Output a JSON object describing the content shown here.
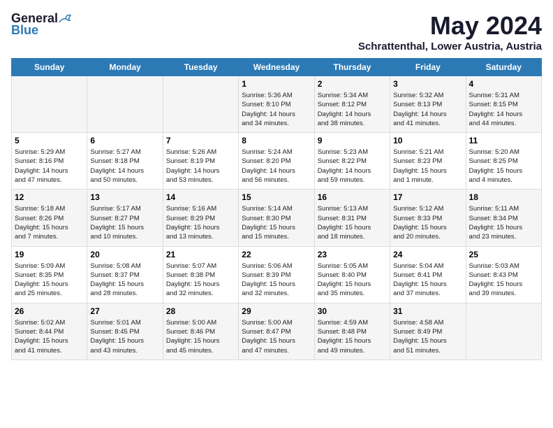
{
  "logo": {
    "general": "General",
    "blue": "Blue"
  },
  "title": "May 2024",
  "subtitle": "Schrattenthal, Lower Austria, Austria",
  "days_of_week": [
    "Sunday",
    "Monday",
    "Tuesday",
    "Wednesday",
    "Thursday",
    "Friday",
    "Saturday"
  ],
  "weeks": [
    [
      {
        "day": "",
        "content": ""
      },
      {
        "day": "",
        "content": ""
      },
      {
        "day": "",
        "content": ""
      },
      {
        "day": "1",
        "content": "Sunrise: 5:36 AM\nSunset: 8:10 PM\nDaylight: 14 hours\nand 34 minutes."
      },
      {
        "day": "2",
        "content": "Sunrise: 5:34 AM\nSunset: 8:12 PM\nDaylight: 14 hours\nand 38 minutes."
      },
      {
        "day": "3",
        "content": "Sunrise: 5:32 AM\nSunset: 8:13 PM\nDaylight: 14 hours\nand 41 minutes."
      },
      {
        "day": "4",
        "content": "Sunrise: 5:31 AM\nSunset: 8:15 PM\nDaylight: 14 hours\nand 44 minutes."
      }
    ],
    [
      {
        "day": "5",
        "content": "Sunrise: 5:29 AM\nSunset: 8:16 PM\nDaylight: 14 hours\nand 47 minutes."
      },
      {
        "day": "6",
        "content": "Sunrise: 5:27 AM\nSunset: 8:18 PM\nDaylight: 14 hours\nand 50 minutes."
      },
      {
        "day": "7",
        "content": "Sunrise: 5:26 AM\nSunset: 8:19 PM\nDaylight: 14 hours\nand 53 minutes."
      },
      {
        "day": "8",
        "content": "Sunrise: 5:24 AM\nSunset: 8:20 PM\nDaylight: 14 hours\nand 56 minutes."
      },
      {
        "day": "9",
        "content": "Sunrise: 5:23 AM\nSunset: 8:22 PM\nDaylight: 14 hours\nand 59 minutes."
      },
      {
        "day": "10",
        "content": "Sunrise: 5:21 AM\nSunset: 8:23 PM\nDaylight: 15 hours\nand 1 minute."
      },
      {
        "day": "11",
        "content": "Sunrise: 5:20 AM\nSunset: 8:25 PM\nDaylight: 15 hours\nand 4 minutes."
      }
    ],
    [
      {
        "day": "12",
        "content": "Sunrise: 5:18 AM\nSunset: 8:26 PM\nDaylight: 15 hours\nand 7 minutes."
      },
      {
        "day": "13",
        "content": "Sunrise: 5:17 AM\nSunset: 8:27 PM\nDaylight: 15 hours\nand 10 minutes."
      },
      {
        "day": "14",
        "content": "Sunrise: 5:16 AM\nSunset: 8:29 PM\nDaylight: 15 hours\nand 13 minutes."
      },
      {
        "day": "15",
        "content": "Sunrise: 5:14 AM\nSunset: 8:30 PM\nDaylight: 15 hours\nand 15 minutes."
      },
      {
        "day": "16",
        "content": "Sunrise: 5:13 AM\nSunset: 8:31 PM\nDaylight: 15 hours\nand 18 minutes."
      },
      {
        "day": "17",
        "content": "Sunrise: 5:12 AM\nSunset: 8:33 PM\nDaylight: 15 hours\nand 20 minutes."
      },
      {
        "day": "18",
        "content": "Sunrise: 5:11 AM\nSunset: 8:34 PM\nDaylight: 15 hours\nand 23 minutes."
      }
    ],
    [
      {
        "day": "19",
        "content": "Sunrise: 5:09 AM\nSunset: 8:35 PM\nDaylight: 15 hours\nand 25 minutes."
      },
      {
        "day": "20",
        "content": "Sunrise: 5:08 AM\nSunset: 8:37 PM\nDaylight: 15 hours\nand 28 minutes."
      },
      {
        "day": "21",
        "content": "Sunrise: 5:07 AM\nSunset: 8:38 PM\nDaylight: 15 hours\nand 32 minutes."
      },
      {
        "day": "22",
        "content": "Sunrise: 5:06 AM\nSunset: 8:39 PM\nDaylight: 15 hours\nand 32 minutes."
      },
      {
        "day": "23",
        "content": "Sunrise: 5:05 AM\nSunset: 8:40 PM\nDaylight: 15 hours\nand 35 minutes."
      },
      {
        "day": "24",
        "content": "Sunrise: 5:04 AM\nSunset: 8:41 PM\nDaylight: 15 hours\nand 37 minutes."
      },
      {
        "day": "25",
        "content": "Sunrise: 5:03 AM\nSunset: 8:43 PM\nDaylight: 15 hours\nand 39 minutes."
      }
    ],
    [
      {
        "day": "26",
        "content": "Sunrise: 5:02 AM\nSunset: 8:44 PM\nDaylight: 15 hours\nand 41 minutes."
      },
      {
        "day": "27",
        "content": "Sunrise: 5:01 AM\nSunset: 8:45 PM\nDaylight: 15 hours\nand 43 minutes."
      },
      {
        "day": "28",
        "content": "Sunrise: 5:00 AM\nSunset: 8:46 PM\nDaylight: 15 hours\nand 45 minutes."
      },
      {
        "day": "29",
        "content": "Sunrise: 5:00 AM\nSunset: 8:47 PM\nDaylight: 15 hours\nand 47 minutes."
      },
      {
        "day": "30",
        "content": "Sunrise: 4:59 AM\nSunset: 8:48 PM\nDaylight: 15 hours\nand 49 minutes."
      },
      {
        "day": "31",
        "content": "Sunrise: 4:58 AM\nSunset: 8:49 PM\nDaylight: 15 hours\nand 51 minutes."
      },
      {
        "day": "",
        "content": ""
      }
    ]
  ]
}
